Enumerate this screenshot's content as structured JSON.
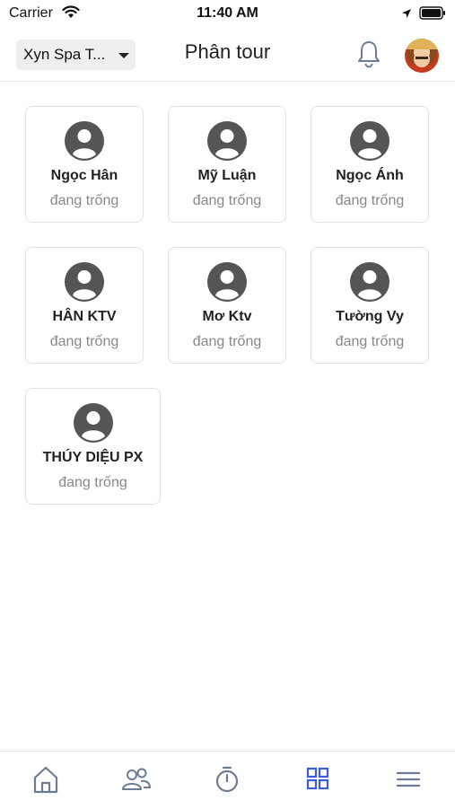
{
  "status_bar": {
    "carrier": "Carrier",
    "time": "11:40 AM"
  },
  "header": {
    "spa_selector": "Xyn Spa T...",
    "title": "Phân tour"
  },
  "staff": [
    {
      "name": "Ngọc Hân",
      "status": "đang trống"
    },
    {
      "name": "Mỹ Luận",
      "status": "đang trống"
    },
    {
      "name": "Ngọc Ánh",
      "status": "đang trống"
    },
    {
      "name": "HÂN KTV",
      "status": "đang trống"
    },
    {
      "name": "Mơ Ktv",
      "status": "đang trống"
    },
    {
      "name": "Tường Vy",
      "status": "đang trống"
    },
    {
      "name": "THÚY DIỆU PX",
      "status": "đang trống"
    }
  ],
  "tabbar": {
    "items": [
      {
        "icon": "home-icon",
        "active": false
      },
      {
        "icon": "users-icon",
        "active": false
      },
      {
        "icon": "timer-icon",
        "active": false
      },
      {
        "icon": "grid-icon",
        "active": true
      },
      {
        "icon": "menu-icon",
        "active": false
      }
    ],
    "active_color": "#3b5bdb",
    "inactive_color": "#6b7c93"
  },
  "colors": {
    "bell": "#6b7c93",
    "avatar_placeholder": "#555555",
    "status_text": "#888888"
  }
}
